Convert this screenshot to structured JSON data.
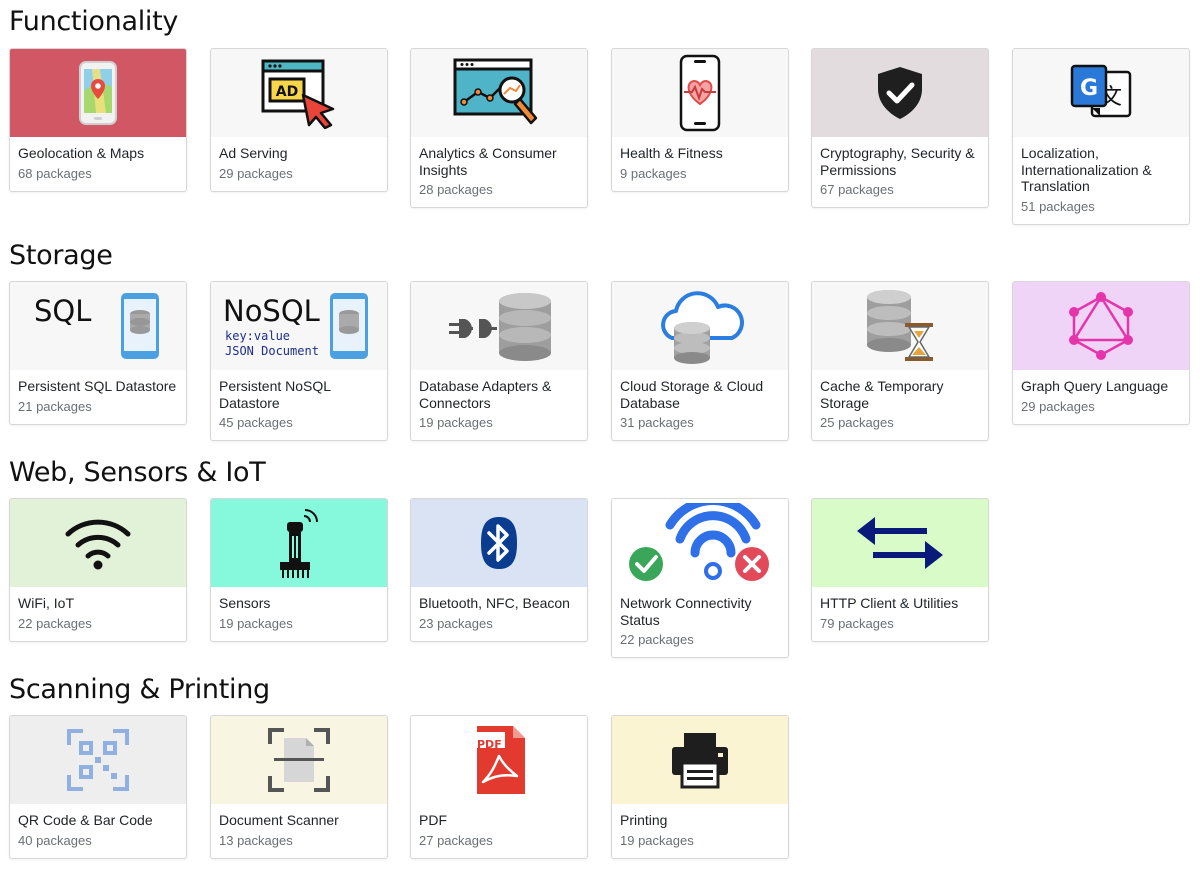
{
  "sections": [
    {
      "title": "Functionality",
      "cards": [
        {
          "title": "Geolocation & Maps",
          "count": "68 packages",
          "icon": "map-pin-phone-icon",
          "bg": "#d05763"
        },
        {
          "title": "Ad Serving",
          "count": "29 packages",
          "icon": "ad-click-icon",
          "bg": "#f7f7f7"
        },
        {
          "title": "Analytics & Consumer Insights",
          "count": "28 packages",
          "icon": "analytics-magnifier-icon",
          "bg": "#f7f7f7"
        },
        {
          "title": "Health & Fitness",
          "count": "9 packages",
          "icon": "heart-phone-icon",
          "bg": "#f7f7f7"
        },
        {
          "title": "Cryptography, Security & Permissions",
          "count": "67 packages",
          "icon": "shield-check-icon",
          "bg": "#e2dcde"
        },
        {
          "title": "Localization, Internationalization & Translation",
          "count": "51 packages",
          "icon": "translate-icon",
          "bg": "#f7f7f7"
        }
      ]
    },
    {
      "title": "Storage",
      "cards": [
        {
          "title": "Persistent SQL Datastore",
          "count": "21 packages",
          "icon": "sql-database-icon",
          "bg": "#f7f7f7",
          "label": "SQL"
        },
        {
          "title": "Persistent NoSQL Datastore",
          "count": "45 packages",
          "icon": "nosql-database-icon",
          "bg": "#f7f7f7",
          "label": "NoSQL",
          "sub1": "key:value",
          "sub2": "JSON Document"
        },
        {
          "title": "Database Adapters & Connectors",
          "count": "19 packages",
          "icon": "database-plug-icon",
          "bg": "#f7f7f7"
        },
        {
          "title": "Cloud Storage & Cloud Database",
          "count": "31 packages",
          "icon": "cloud-database-icon",
          "bg": "#f7f7f7"
        },
        {
          "title": "Cache & Temporary Storage",
          "count": "25 packages",
          "icon": "database-hourglass-icon",
          "bg": "#f7f7f7"
        },
        {
          "title": "Graph Query Language",
          "count": "29 packages",
          "icon": "graphql-icon",
          "bg": "#f0d4f7"
        }
      ]
    },
    {
      "title": "Web, Sensors & IoT",
      "cards": [
        {
          "title": "WiFi, IoT",
          "count": "22 packages",
          "icon": "wifi-icon",
          "bg": "#e2f2d9"
        },
        {
          "title": "Sensors",
          "count": "19 packages",
          "icon": "sensor-icon",
          "bg": "#86f8dc"
        },
        {
          "title": "Bluetooth, NFC, Beacon",
          "count": "23 packages",
          "icon": "bluetooth-icon",
          "bg": "#d9e3f3"
        },
        {
          "title": "Network Connectivity Status",
          "count": "22 packages",
          "icon": "network-status-icon",
          "bg": "#ffffff"
        },
        {
          "title": "HTTP Client & Utilities",
          "count": "79 packages",
          "icon": "arrows-exchange-icon",
          "bg": "#d8fbc8"
        }
      ]
    },
    {
      "title": "Scanning & Printing",
      "cards": [
        {
          "title": "QR Code & Bar Code",
          "count": "40 packages",
          "icon": "qr-code-icon",
          "bg": "#eeeeee"
        },
        {
          "title": "Document Scanner",
          "count": "13 packages",
          "icon": "document-scanner-icon",
          "bg": "#f8f5e2"
        },
        {
          "title": "PDF",
          "count": "27 packages",
          "icon": "pdf-file-icon",
          "bg": "#ffffff",
          "label": "PDF"
        },
        {
          "title": "Printing",
          "count": "19 packages",
          "icon": "printer-icon",
          "bg": "#fbf4d2"
        }
      ]
    }
  ]
}
